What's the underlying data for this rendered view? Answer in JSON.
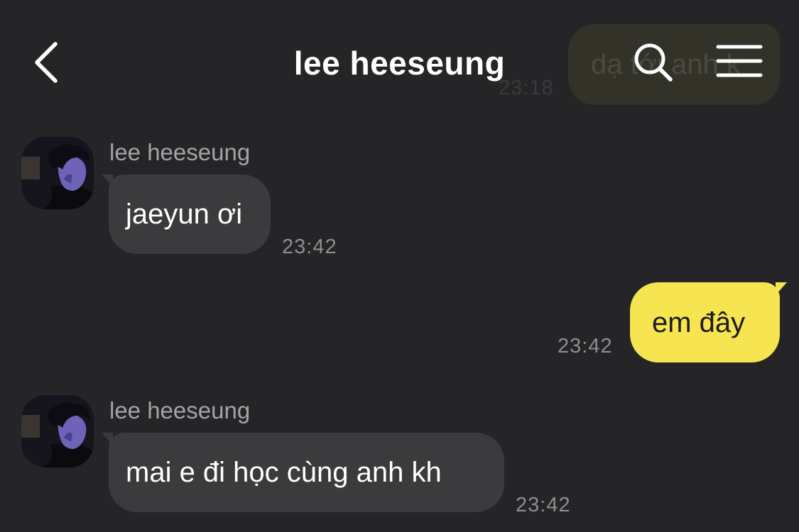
{
  "header": {
    "title": "lee heeseung",
    "back_icon": "chevron-left-icon",
    "search_icon": "search-icon",
    "menu_icon": "hamburger-menu-icon"
  },
  "background_message": {
    "text": "dạ tới anh k",
    "time": "23:18"
  },
  "messages": [
    {
      "direction": "received",
      "sender": "lee heeseung",
      "text": "jaeyun ơi",
      "time": "23:42"
    },
    {
      "direction": "sent",
      "text": "em đây",
      "time": "23:42"
    },
    {
      "direction": "received",
      "sender": "lee heeseung",
      "text": "mai e đi học cùng anh kh",
      "time": "23:42"
    }
  ],
  "colors": {
    "background": "#252527",
    "received_bubble": "#3b3b3d",
    "sent_bubble": "#f6e451",
    "timestamp": "#8e8e90"
  }
}
